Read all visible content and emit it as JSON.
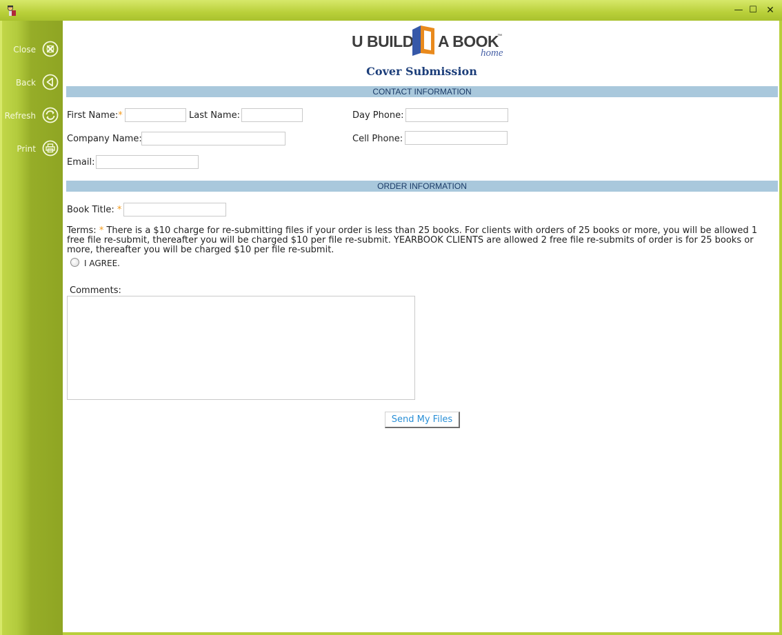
{
  "window": {
    "minimize_glyph": "—",
    "maximize_glyph": "☐",
    "close_glyph": "✕"
  },
  "sidebar": {
    "items": [
      {
        "label": "Close",
        "icon": "close-circle-icon"
      },
      {
        "label": "Back",
        "icon": "back-circle-icon"
      },
      {
        "label": "Refresh",
        "icon": "refresh-circle-icon"
      },
      {
        "label": "Print",
        "icon": "print-circle-icon"
      }
    ]
  },
  "logo": {
    "left": "U BUILD",
    "right": "A BOOK",
    "tm": "™",
    "home": "home"
  },
  "page": {
    "title": "Cover Submission"
  },
  "contact": {
    "header": "CONTACT INFORMATION",
    "first_name_label": "First Name:",
    "last_name_label": "Last Name:",
    "day_phone_label": "Day Phone:",
    "company_label": "Company Name:",
    "cell_phone_label": "Cell Phone:",
    "email_label": "Email:",
    "required_mark": "*",
    "first_name": "",
    "last_name": "",
    "day_phone": "",
    "company": "",
    "cell_phone": "",
    "email": ""
  },
  "order": {
    "header": "ORDER INFORMATION",
    "book_title_label": "Book Title:",
    "required_mark": "*",
    "book_title": "",
    "terms_label": "Terms:",
    "terms_text": "There is a $10 charge for re-submitting files if your order is less than 25 books. For clients with orders of 25 books or more, you will be allowed 1 free file re-submit, thereafter you will be charged $10 per file re-submit. YEARBOOK CLIENTS are allowed 2 free file re-submits of order is for 25 books or more, thereafter you will be charged $10 per file re-submit.",
    "agree_label": "I AGREE.",
    "agree_checked": false,
    "comments_label": "Comments:",
    "comments": "",
    "submit_label": "Send My Files"
  },
  "colors": {
    "frame": "#a8c030",
    "section_bar": "#a9c8dc",
    "title": "#1c3e7a",
    "required": "#f29a1c",
    "button_text": "#2a8fd6"
  }
}
